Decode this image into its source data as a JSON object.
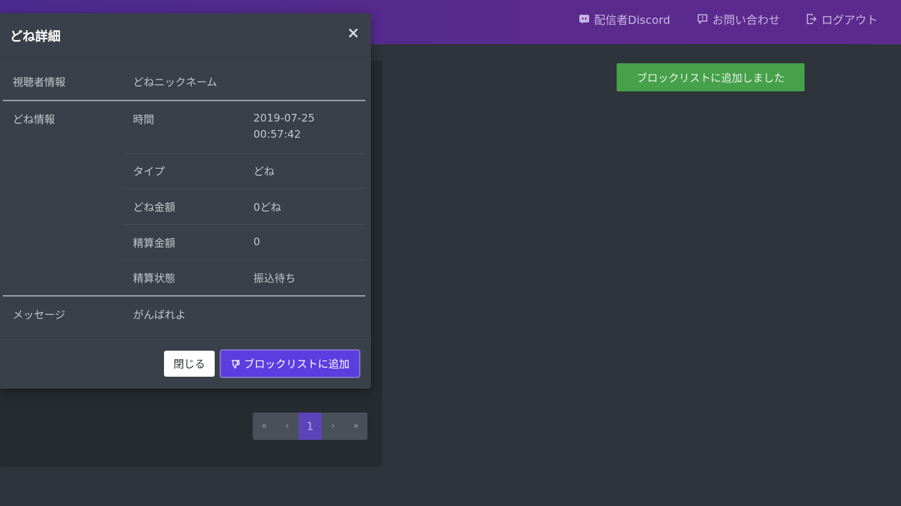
{
  "header": {
    "nav": {
      "discord": "配信者Discord",
      "contact": "お問い合わせ",
      "logout": "ログアウト"
    }
  },
  "toast": {
    "message": "ブロックリストに追加しました"
  },
  "pagination": {
    "first": "«",
    "prev": "‹",
    "current": "1",
    "next": "›",
    "last": "»"
  },
  "modal": {
    "title": "どね詳細",
    "close_symbol": "×",
    "viewer": {
      "label": "視聴者情報",
      "value": "どねニックネーム"
    },
    "done_info": {
      "label": "どね情報",
      "rows": [
        {
          "key": "時間",
          "value_line1": "2019-07-25",
          "value_line2": "00:57:42"
        },
        {
          "key": "タイプ",
          "value": "どね"
        },
        {
          "key": "どね金額",
          "value": "0どね"
        },
        {
          "key": "精算金額",
          "value": "0"
        },
        {
          "key": "精算状態",
          "value": "振込待ち"
        }
      ]
    },
    "message": {
      "label": "メッセージ",
      "value": "がんばれよ"
    },
    "buttons": {
      "close": "閉じる",
      "block": "ブロックリストに追加"
    }
  },
  "colors": {
    "header_gradient_start": "#4a2a8e",
    "header_gradient_end": "#5d2a8e",
    "toast_green": "#47a04a",
    "primary_purple": "#5a3ee0",
    "modal_bg": "#3a4049",
    "page_bg": "#2e343b"
  },
  "icons": {
    "discord": "discord-icon",
    "contact": "speech-bubble-icon",
    "logout": "logout-icon",
    "block": "thumbs-down-icon",
    "close": "close-icon"
  }
}
